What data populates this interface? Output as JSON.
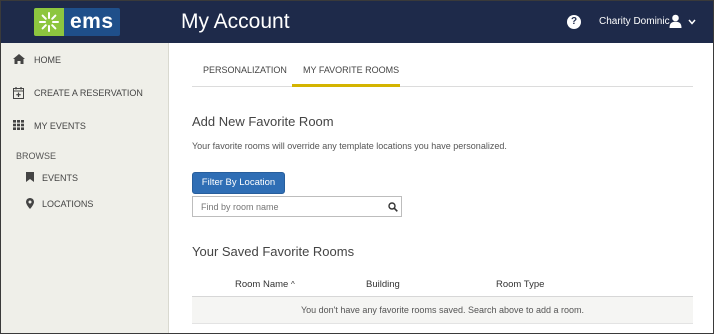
{
  "header": {
    "logo_text": "ems",
    "title": "My Account",
    "help_label": "?",
    "user_name": "Charity Dominic"
  },
  "sidebar": {
    "items": [
      {
        "label": "HOME",
        "icon": "home-icon"
      },
      {
        "label": "CREATE A RESERVATION",
        "icon": "calendar-plus-icon"
      },
      {
        "label": "MY EVENTS",
        "icon": "grid-icon"
      }
    ],
    "browse_label": "BROWSE",
    "browse_items": [
      {
        "label": "EVENTS",
        "icon": "bookmark-icon"
      },
      {
        "label": "LOCATIONS",
        "icon": "map-pin-icon"
      }
    ]
  },
  "tabs": [
    {
      "label": "PERSONALIZATION",
      "active": false
    },
    {
      "label": "MY FAVORITE ROOMS",
      "active": true
    }
  ],
  "add_section": {
    "title": "Add New Favorite Room",
    "help_text": "Your favorite rooms will override any template locations you have personalized.",
    "filter_button": "Filter By Location",
    "search_placeholder": "Find by room name"
  },
  "saved_section": {
    "title": "Your Saved Favorite Rooms",
    "columns": [
      "Room Name",
      "Building",
      "Room Type"
    ],
    "sort_indicator": "^",
    "empty_message": "You don't have any favorite rooms saved. Search above to add a room."
  },
  "colors": {
    "header_bg": "#1e2a4a",
    "logo_green": "#8dc63f",
    "button_blue": "#2f6eb5",
    "tab_accent": "#d4b400",
    "sidebar_bg": "#efefe9"
  }
}
